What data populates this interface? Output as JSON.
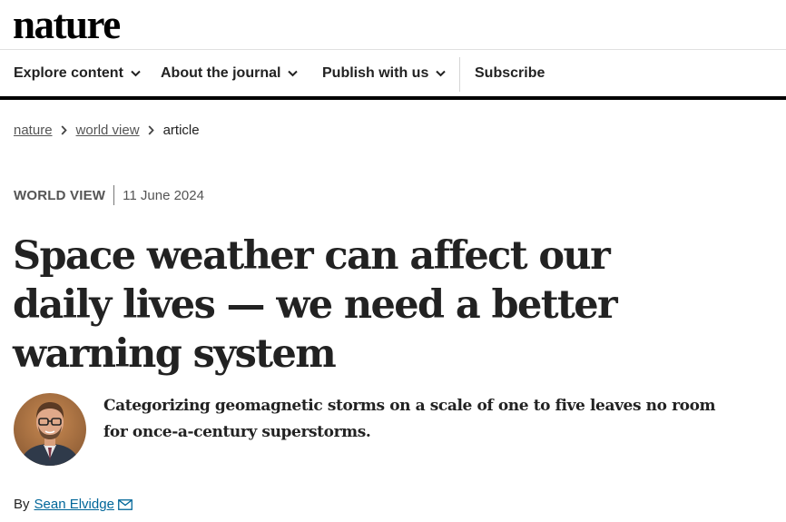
{
  "site": {
    "logo": "nature"
  },
  "nav": {
    "items": [
      {
        "label": "Explore content"
      },
      {
        "label": "About the journal"
      },
      {
        "label": "Publish with us"
      }
    ],
    "subscribe_label": "Subscribe"
  },
  "breadcrumb": [
    "nature",
    "world view",
    "article"
  ],
  "article": {
    "type": "WORLD VIEW",
    "date": "11 June 2024",
    "title": "Space weather can affect our daily lives — we need a better warning system",
    "standfirst": "Categorizing geomagnetic storms on a scale of one to five leaves no room for once-a-century superstorms.",
    "byline_prefix": "By",
    "author": "Sean Elvidge"
  },
  "icons": {
    "nav_chevron": "chevron-down-icon",
    "breadcrumb_separator": "chevron-right-icon",
    "author_email": "mail-icon",
    "author_photo": "author-avatar"
  },
  "colors": {
    "link": "#006699",
    "text": "#222222",
    "nav_rule": "#000000"
  }
}
